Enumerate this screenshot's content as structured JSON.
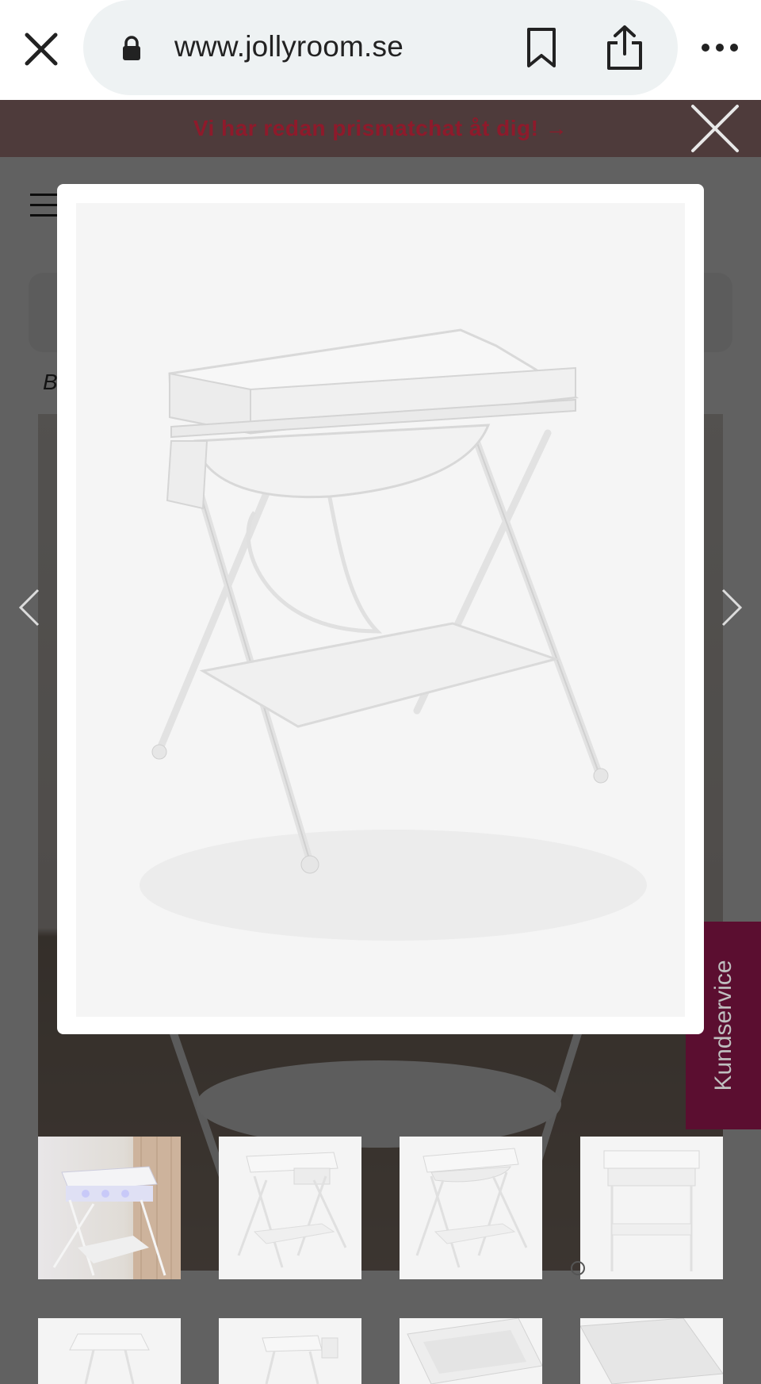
{
  "browser": {
    "url": "www.jollyroom.se",
    "close_icon": "close-icon",
    "lock_icon": "lock-icon",
    "bookmark_icon": "bookmark-icon",
    "share_icon": "share-icon",
    "more_icon": "more-icon"
  },
  "promo": {
    "text": "Vi har redan prismatchat åt dig! →"
  },
  "background": {
    "breadcrumb_fragment": "B",
    "kundservice_label": "Kundservice"
  },
  "gallery": {
    "close_icon": "close-icon",
    "prev_icon": "chevron-left-icon",
    "next_icon": "chevron-right-icon",
    "main_image_alt": "Skötbord med badkar, vitt",
    "thumbnails_row1": [
      "lifestyle",
      "front-angle",
      "front-angle-open",
      "front"
    ],
    "thumbnails_row2": [
      "top",
      "side",
      "tub",
      "mat"
    ]
  },
  "colors": {
    "promo_text": "#8e1a2b",
    "kundservice_bg": "#7a1340",
    "scrim": "rgba(0,0,0,0.62)"
  }
}
